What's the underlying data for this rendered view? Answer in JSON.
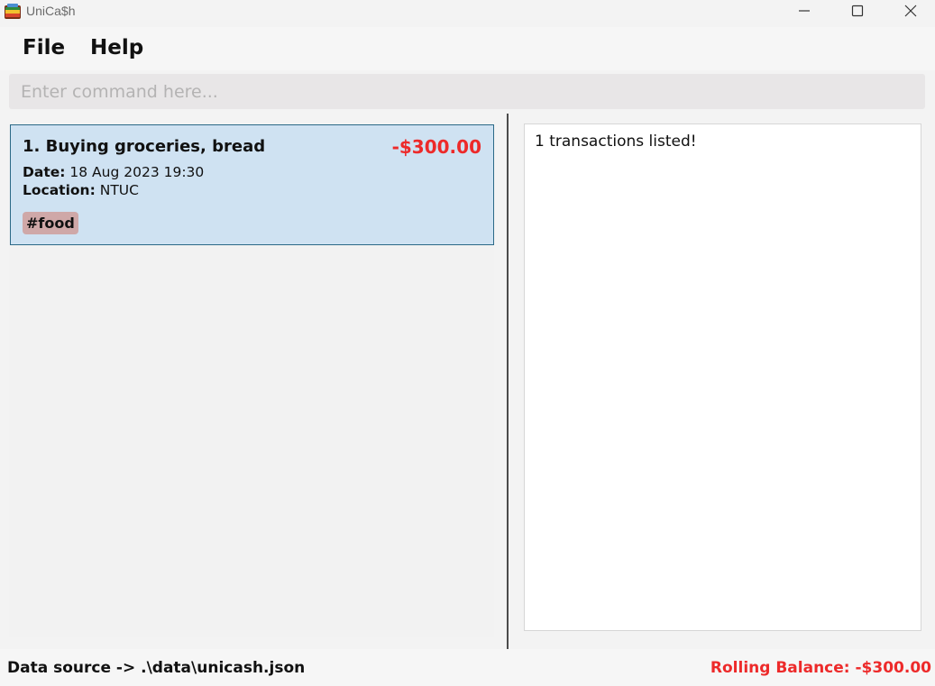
{
  "window": {
    "title": "UniCa$h"
  },
  "menu": {
    "file_label": "File",
    "help_label": "Help"
  },
  "command": {
    "placeholder": "Enter command here...",
    "value": ""
  },
  "transactions": [
    {
      "title": "1. Buying groceries, bread",
      "amount": "-$300.00",
      "date_label": "Date:",
      "date_value": "18 Aug 2023 19:30",
      "location_label": "Location:",
      "location_value": "NTUC",
      "tags": [
        "#food"
      ]
    }
  ],
  "result": {
    "message": "1 transactions listed!"
  },
  "status": {
    "data_source": "Data source -> .\\data\\unicash.json",
    "rolling_balance": "Rolling Balance: -$300.00"
  },
  "colors": {
    "accent_red": "#ed2a2a",
    "card_bg": "#cfe2f2",
    "card_border": "#2b6987",
    "tag_bg": "#cfa8a8"
  },
  "icons": {
    "app": "wallet-icon",
    "minimize": "minimize-icon",
    "maximize": "maximize-icon",
    "close": "close-icon"
  }
}
